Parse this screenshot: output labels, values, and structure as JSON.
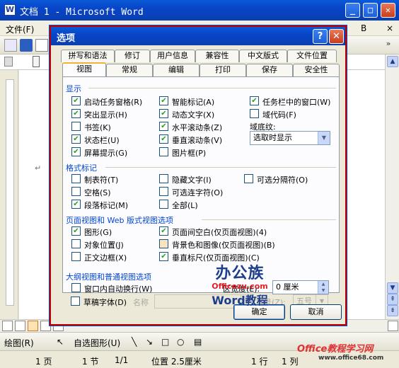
{
  "word": {
    "title": "文档 1 - Microsoft Word",
    "menu_file": "文件(F)",
    "menu_help": "B",
    "close_doc": "×",
    "paragraph_mark": "↵"
  },
  "dialog": {
    "title": "选项",
    "help_button": "?",
    "close_button": "✕",
    "tabs_row1": [
      "拼写和语法",
      "修订",
      "用户信息",
      "兼容性",
      "中文版式",
      "文件位置"
    ],
    "tabs_row2": [
      "视图",
      "常规",
      "编辑",
      "打印",
      "保存",
      "安全性"
    ],
    "sections": {
      "display": "显示",
      "format_marks": "格式标记",
      "page_web": "页面视图和 Web 版式视图选项",
      "outline": "大纲视图和普通视图选项"
    },
    "display_options": [
      {
        "label": "启动任务窗格(R)",
        "checked": true
      },
      {
        "label": "突出显示(H)",
        "checked": true
      },
      {
        "label": "书签(K)",
        "checked": false
      },
      {
        "label": "状态栏(U)",
        "checked": true
      },
      {
        "label": "屏幕提示(G)",
        "checked": true
      },
      {
        "label": "智能标记(A)",
        "checked": true
      },
      {
        "label": "动态文字(X)",
        "checked": true
      },
      {
        "label": "水平滚动条(Z)",
        "checked": true
      },
      {
        "label": "垂直滚动条(V)",
        "checked": true
      },
      {
        "label": "图片框(P)",
        "checked": false
      },
      {
        "label": "任务栏中的窗口(W)",
        "checked": true
      },
      {
        "label": "域代码(F)",
        "checked": false
      }
    ],
    "field_shading_label": "域底纹:",
    "field_shading_value": "选取时显示",
    "format_marks_options": [
      {
        "label": "制表符(T)",
        "checked": false
      },
      {
        "label": "空格(S)",
        "checked": false
      },
      {
        "label": "段落标记(M)",
        "checked": true
      },
      {
        "label": "隐藏文字(I)",
        "checked": false
      },
      {
        "label": "可选连字符(O)",
        "checked": false
      },
      {
        "label": "全部(L)",
        "checked": false
      },
      {
        "label": "可选分隔符(O)",
        "checked": false
      }
    ],
    "page_options": [
      {
        "label": "图形(G)",
        "checked": true
      },
      {
        "label": "对象位置(J)",
        "checked": false
      },
      {
        "label": "正文边框(X)",
        "checked": false
      },
      {
        "label": "页面间空白(仅页面视图)(4)",
        "checked": true
      },
      {
        "label": "背景色和图像(仅页面视图)(B)",
        "checked": false
      },
      {
        "label": "垂直标尺(仅页面视图)(C)",
        "checked": true
      }
    ],
    "outline_options": [
      {
        "label": "窗口内自动换行(W)",
        "checked": false
      },
      {
        "label": "草稿字体(D)",
        "checked": false
      }
    ],
    "name_label": "名称",
    "width_label": "区宽度(E):",
    "width_value": "0 厘米",
    "font_size_label": "字号(Z):",
    "font_size_value": "五号",
    "ok": "确定",
    "cancel": "取消",
    "watermark_line1": "办公族",
    "watermark_line2": "Officezu.com",
    "watermark_line3": "Word教程"
  },
  "draw_toolbar": {
    "draw_label": "绘图(R)",
    "autoshapes_label": "自选图形(U)"
  },
  "statusbar": {
    "page": "1 页",
    "section": "1 节",
    "pages": "1/1",
    "position": "位置 2.5厘米",
    "line": "1 行",
    "col": "1 列"
  },
  "watermark2": {
    "line1": "Office教程学习网",
    "line2": "www.office68.com"
  },
  "colors": {
    "title_blue": "#0845c8",
    "section_blue": "#0046d5",
    "check_green": "#21a121",
    "highlight_red": "#c00000"
  }
}
